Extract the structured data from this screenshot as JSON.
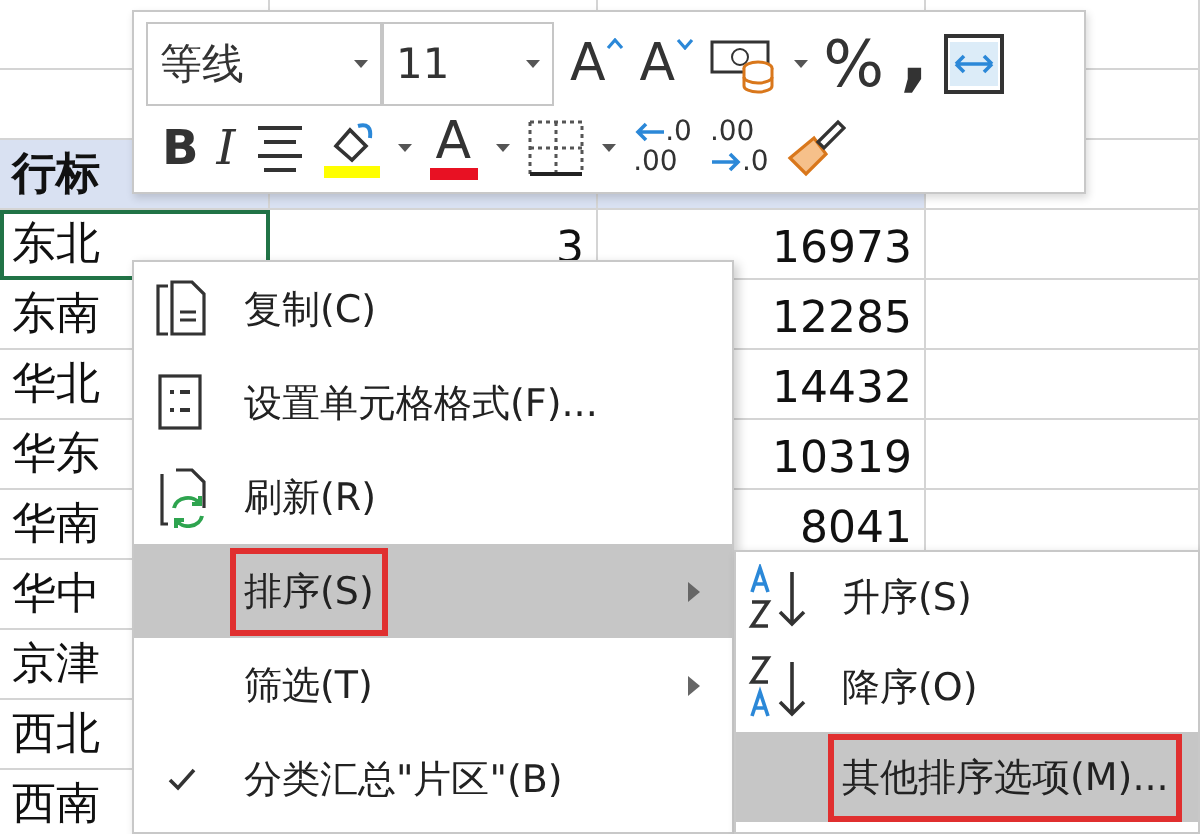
{
  "sheet": {
    "header": {
      "row_label": "行标"
    },
    "rows": [
      {
        "region": "东北",
        "count": "3",
        "sum": "16973",
        "selected": true
      },
      {
        "region": "东南",
        "sum": "12285",
        "selected": false
      },
      {
        "region": "华北",
        "sum": "14432",
        "selected": false
      },
      {
        "region": "华东",
        "sum": "10319",
        "selected": false
      },
      {
        "region": "华南",
        "sum": "8041",
        "selected": false
      },
      {
        "region": "华中",
        "selected": false
      },
      {
        "region": "京津",
        "selected": false
      },
      {
        "region": "西北",
        "selected": false
      },
      {
        "region": "西南",
        "selected": false
      }
    ]
  },
  "mini_toolbar": {
    "font": "等线",
    "size": "11",
    "row_1": [
      {
        "kind": "grow",
        "glyph": "A"
      },
      {
        "kind": "shrink",
        "glyph": "A"
      },
      {
        "kind": "accounting"
      },
      {
        "kind": "percent",
        "glyph": "%"
      },
      {
        "kind": "comma",
        "glyph": ","
      },
      {
        "kind": "wrap"
      }
    ],
    "row_2": [
      {
        "kind": "bold",
        "glyph": "B"
      },
      {
        "kind": "italic",
        "glyph": "I"
      },
      {
        "kind": "align"
      },
      {
        "kind": "fill"
      },
      {
        "kind": "font-color",
        "glyph": "A"
      },
      {
        "kind": "borders"
      },
      {
        "kind": "increase-decimal",
        "top": ".0",
        "bottom": ".00"
      },
      {
        "kind": "decrease-decimal",
        "top": ".00",
        "bottom": ".0"
      },
      {
        "kind": "painter"
      }
    ]
  },
  "context_menu": [
    {
      "kind": "copy",
      "label": "复制(C)",
      "selected": false,
      "annotated": false,
      "checked": false
    },
    {
      "kind": "format",
      "label": "设置单元格格式(F)...",
      "selected": false,
      "annotated": false,
      "checked": false
    },
    {
      "kind": "refresh",
      "label": "刷新(R)",
      "selected": false,
      "annotated": false,
      "checked": false
    },
    {
      "kind": "submenu",
      "label": "排序(S)",
      "selected": true,
      "annotated": true,
      "checked": false
    },
    {
      "kind": "submenu",
      "label": "筛选(T)",
      "selected": false,
      "annotated": false,
      "checked": false
    },
    {
      "kind": "plain",
      "label": "分类汇总\"片区\"(B)",
      "selected": false,
      "annotated": false,
      "checked": true
    }
  ],
  "sort_submenu": [
    {
      "kind": "ascending",
      "label": "升序(S)",
      "selected": false,
      "annotated": false
    },
    {
      "kind": "descending",
      "label": "降序(O)",
      "selected": false,
      "annotated": false
    },
    {
      "kind": "plain",
      "label": "其他排序选项(M)...",
      "selected": true,
      "annotated": true
    }
  ]
}
